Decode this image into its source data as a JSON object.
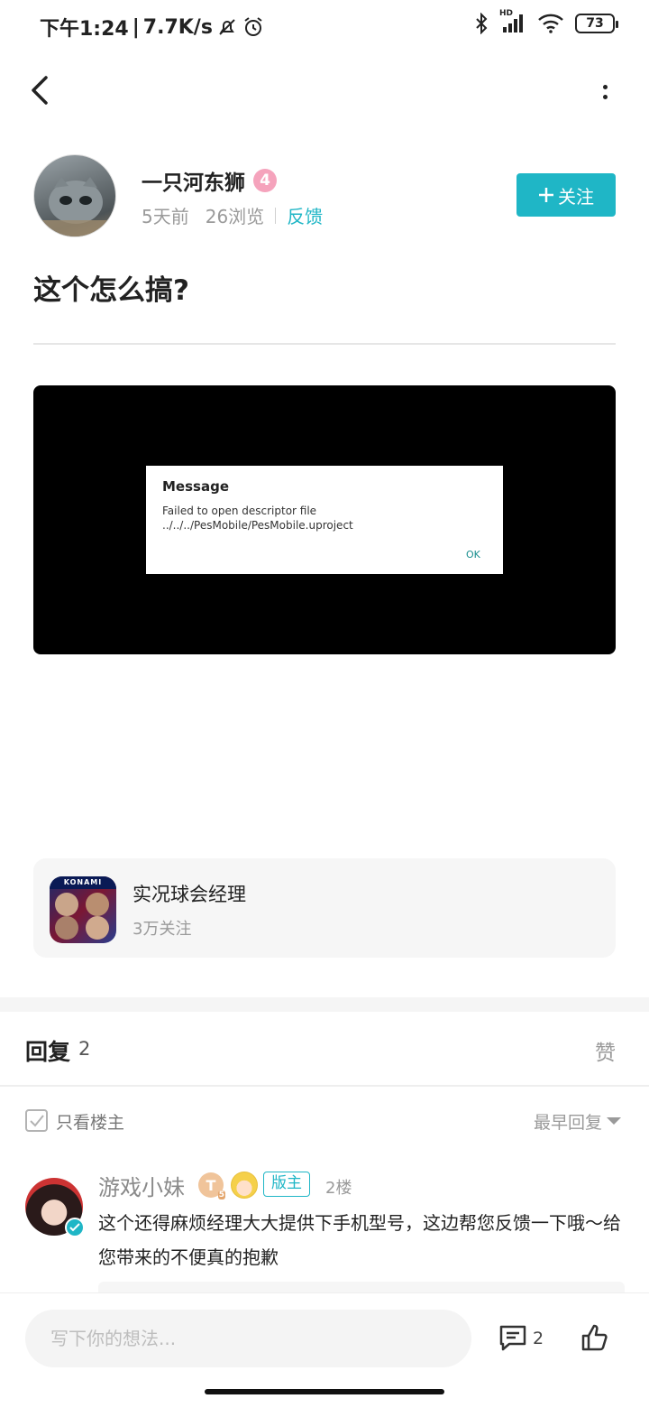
{
  "status_bar": {
    "time": "下午1:24",
    "net_speed": "7.7K/s",
    "battery": "73",
    "network_label": "HD"
  },
  "header": {
    "back_icon": "back-icon",
    "more_icon": "more-icon"
  },
  "post": {
    "author": {
      "name": "一只河东狮",
      "level": "4",
      "time_ago": "5天前",
      "views": "26浏览",
      "feedback_link": "反馈"
    },
    "follow_button": "关注",
    "title": "这个怎么搞?",
    "image": {
      "dialog_title": "Message",
      "dialog_message": "Failed to open descriptor file ../../../PesMobile/PesMobile.uproject",
      "dialog_ok": "OK"
    }
  },
  "game": {
    "name": "实况球会经理",
    "followers": "3万关注",
    "icon_label": "KONAMI"
  },
  "replies": {
    "title": "回复",
    "count": "2",
    "like_label": "赞",
    "only_op_label": "只看楼主",
    "sort_label": "最早回复",
    "items": [
      {
        "name": "游戏小妹",
        "badge_t": "T",
        "badge_t_sub": "5",
        "role_badge": "版主",
        "floor": "2楼",
        "content": "这个还得麻烦经理大大提供下手机型号，这边帮您反馈一下哦～给您带来的不便真的抱歉"
      }
    ]
  },
  "bottom_bar": {
    "input_placeholder": "写下你的想法...",
    "comment_count": "2"
  },
  "colors": {
    "accent": "#1fb6c6",
    "level_badge": "#f5a3bc",
    "muted_text": "#9a9a9a"
  }
}
